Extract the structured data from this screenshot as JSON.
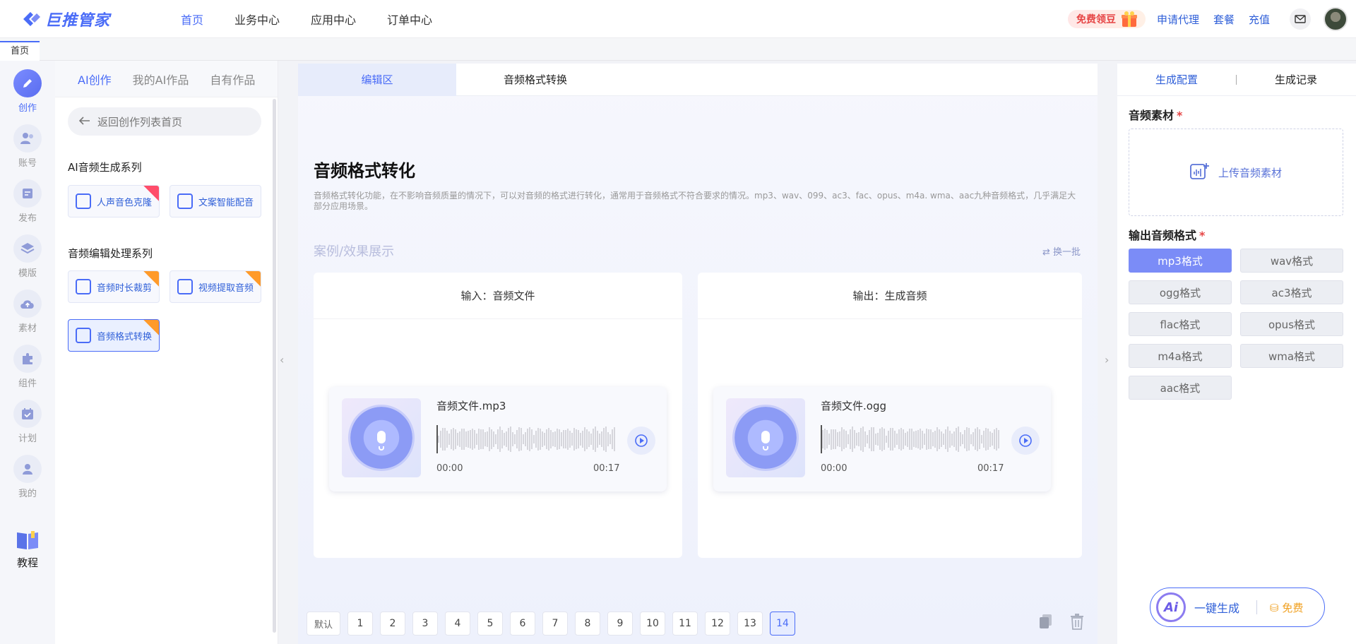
{
  "app": {
    "logo_text": "巨推管家",
    "nav": [
      "首页",
      "业务中心",
      "应用中心",
      "订单中心"
    ],
    "free_beans": "免费领豆",
    "links": [
      "申请代理",
      "套餐",
      "充值"
    ]
  },
  "tabs": {
    "home": "首页"
  },
  "iconbar": {
    "items": [
      "创作",
      "账号",
      "发布",
      "模版",
      "素材",
      "组件",
      "计划",
      "我的"
    ],
    "tutorial": "教程"
  },
  "leftpanel": {
    "tabs": [
      "AI创作",
      "我的AI作品",
      "自有作品"
    ],
    "back": "返回创作列表首页",
    "section1": "AI音频生成系列",
    "tools1": [
      "人声音色克隆",
      "文案智能配音"
    ],
    "section2": "音频编辑处理系列",
    "tools2": [
      "音频时长裁剪",
      "视频提取音频",
      "音频格式转换"
    ]
  },
  "main": {
    "tabs": [
      "编辑区",
      "音频格式转换"
    ],
    "title": "音频格式转化",
    "description": "音频格式转化功能，在不影响音频质量的情况下，可以对音频的格式进行转化，通常用于音频格式不符合要求的情况。mp3、wav、099、ac3、fac、opus、m4a. wma、aac九种音频格式，几乎满足大部分应用场景。",
    "case_title": "案例/效果展示",
    "shuffle": "换一批",
    "input": {
      "header": "输入：音频文件",
      "file": "音频文件.mp3",
      "start": "00:00",
      "end": "00:17"
    },
    "output": {
      "header": "输出：生成音频",
      "file": "音频文件.ogg",
      "start": "00:00",
      "end": "00:17"
    }
  },
  "pager": {
    "default": "默认",
    "pages": [
      "1",
      "2",
      "3",
      "4",
      "5",
      "6",
      "7",
      "8",
      "9",
      "10",
      "11",
      "12",
      "13",
      "14"
    ],
    "active": "14"
  },
  "rightpanel": {
    "tabs": [
      "生成配置",
      "生成记录"
    ],
    "audio_label": "音频素材",
    "required": "*",
    "upload": "上传音频素材",
    "format_label": "输出音频格式",
    "formats": [
      "mp3格式",
      "wav格式",
      "ogg格式",
      "ac3格式",
      "flac格式",
      "opus格式",
      "m4a格式",
      "wma格式",
      "aac格式"
    ],
    "selected_format": "mp3格式",
    "generate": "一键生成",
    "ai_badge": "Ai",
    "free": "免费"
  },
  "colors": {
    "accent": "#4a6cf7",
    "selected_format": "#7b8cf7",
    "link": "#2f5fd8"
  }
}
